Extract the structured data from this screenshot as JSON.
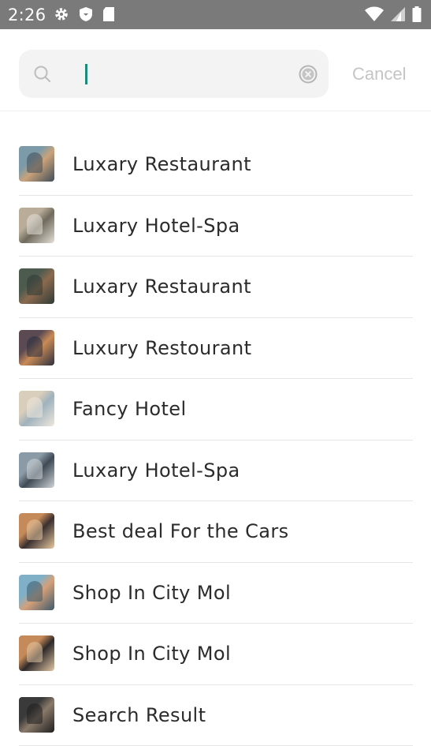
{
  "status_bar": {
    "time": "2:26",
    "left_icons": [
      "gear-icon",
      "shield-icon",
      "sd-card-icon"
    ],
    "right_icons": [
      "wifi-icon",
      "signal-icon",
      "battery-icon"
    ]
  },
  "search": {
    "value": "",
    "placeholder": "",
    "cancel_label": "Cancel"
  },
  "results": [
    {
      "label": "Luxary Restaurant",
      "thumb_colors": [
        "#7d9aa8",
        "#c9a27a",
        "#3f4d58"
      ]
    },
    {
      "label": "Luxary Hotel-Spa",
      "thumb_colors": [
        "#b9ad9a",
        "#6f6a5c",
        "#e4e0d8"
      ]
    },
    {
      "label": "Luxary Restaurant",
      "thumb_colors": [
        "#4d5a4e",
        "#8b6a4e",
        "#2f3a36"
      ]
    },
    {
      "label": "Luxury Restourant",
      "thumb_colors": [
        "#5b4a52",
        "#c98b56",
        "#2a3040"
      ]
    },
    {
      "label": "Fancy Hotel",
      "thumb_colors": [
        "#d9cdbb",
        "#9fb2bd",
        "#efe8dd"
      ]
    },
    {
      "label": "Luxary Hotel-Spa",
      "thumb_colors": [
        "#8a9aa6",
        "#3f4a54",
        "#cfd5d8"
      ]
    },
    {
      "label": "Best deal For the Cars",
      "thumb_colors": [
        "#c58a5a",
        "#3a3030",
        "#e8c9a0"
      ]
    },
    {
      "label": "Shop In City Mol",
      "thumb_colors": [
        "#7fb0c7",
        "#d4a07a",
        "#3d5a6a"
      ]
    },
    {
      "label": "Shop In City Mol",
      "thumb_colors": [
        "#c58a5a",
        "#2e2a2a",
        "#e2c7a4"
      ]
    },
    {
      "label": "Search Result",
      "thumb_colors": [
        "#3a3a3a",
        "#8a7a6a",
        "#1f1f1f"
      ]
    }
  ],
  "colors": {
    "status_bar_bg": "#7a7a7a",
    "caret": "#1e8a7a",
    "cancel_text": "#c5c5c5",
    "search_bg": "#f3f3f3"
  }
}
